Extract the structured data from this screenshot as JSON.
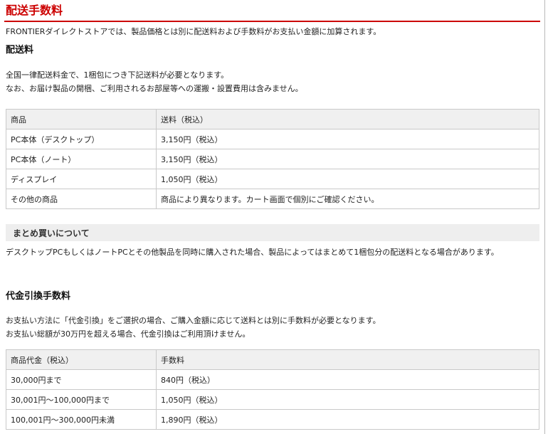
{
  "page_title": "配送手数料",
  "intro": "FRONTIERダイレクトストアでは、製品価格とは別に配送料および手数料がお支払い金額に加算されます。",
  "shipping": {
    "heading": "配送料",
    "notes": [
      "全国一律配送料金で、1梱包につき下記送料が必要となります。",
      "なお、お届け製品の開梱、ご利用されるお部屋等への運搬・設置費用は含みません。"
    ],
    "table": {
      "headers": [
        "商品",
        "送料（税込）"
      ],
      "rows": [
        [
          "PC本体（デスクトップ）",
          "3,150円（税込）"
        ],
        [
          "PC本体（ノート）",
          "3,150円（税込）"
        ],
        [
          "ディスプレイ",
          "1,050円（税込）"
        ],
        [
          "その他の商品",
          "商品により異なります。カート画面で個別にご確認ください。"
        ]
      ]
    }
  },
  "bulk": {
    "heading": "まとめ買いについて",
    "text": "デスクトップPCもしくはノートPCとその他製品を同時に購入された場合、製品によってはまとめて1梱包分の配送料となる場合があります。"
  },
  "cod": {
    "heading": "代金引換手数料",
    "notes": [
      "お支払い方法に「代金引換」をご選択の場合、ご購入金額に応じて送料とは別に手数料が必要となります。",
      "お支払い総額が30万円を超える場合、代金引換はご利用頂けません。"
    ],
    "table": {
      "headers": [
        "商品代金（税込）",
        "手数料"
      ],
      "rows": [
        [
          "30,000円まで",
          "840円（税込）"
        ],
        [
          "30,001円～100,000円まで",
          "1,050円（税込）"
        ],
        [
          "100,001円～300,000円未満",
          "1,890円（税込）"
        ]
      ]
    }
  }
}
